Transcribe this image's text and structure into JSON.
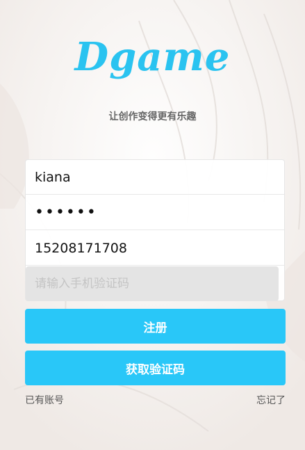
{
  "brand": {
    "logo_text": "Dgame",
    "slogan": "让创作变得更有乐趣",
    "accent_color": "#29c7f8"
  },
  "form": {
    "username_value": "kiana",
    "password_value": "••••••",
    "phone_value": "15208171708",
    "code_placeholder": "请输入手机验证码",
    "register_label": "注册",
    "get_code_label": "获取验证码"
  },
  "links": {
    "have_account": "已有账号",
    "forgot": "忘记了"
  }
}
